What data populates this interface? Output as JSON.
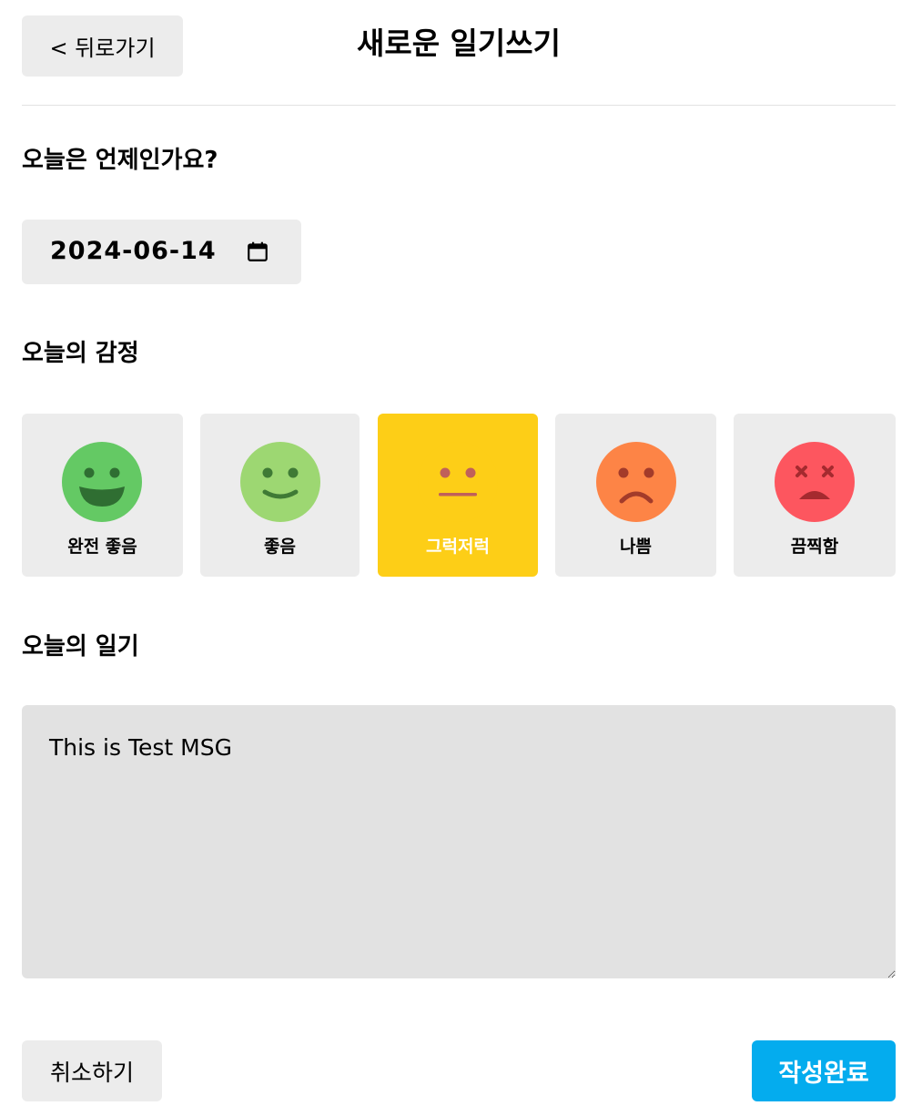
{
  "header": {
    "back_label": "< 뒤로가기",
    "title": "새로운 일기쓰기"
  },
  "date_section": {
    "title": "오늘은 언제인가요?",
    "date_value": "2024-06-14",
    "picker_icon": "calendar-icon"
  },
  "emotion_section": {
    "title": "오늘의 감정",
    "selected": "그럭저럭",
    "items": [
      {
        "label": "완전 좋음",
        "icon": "very-happy-face-icon",
        "color": "#64c964"
      },
      {
        "label": "좋음",
        "icon": "happy-face-icon",
        "color": "#9dd772"
      },
      {
        "label": "그럭저럭",
        "icon": "neutral-face-icon",
        "color": "#fdce17"
      },
      {
        "label": "나쁨",
        "icon": "sad-face-icon",
        "color": "#fd8446"
      },
      {
        "label": "끔찍함",
        "icon": "terrible-face-icon",
        "color": "#fd565f"
      }
    ]
  },
  "diary_section": {
    "title": "오늘의 일기",
    "text": "This is Test MSG"
  },
  "actions": {
    "cancel_label": "취소하기",
    "submit_label": "작성완료"
  },
  "colors": {
    "selected_card": "#fdce17",
    "submit_button": "#04acee",
    "card_background": "#ececec",
    "textarea_background": "#e2e2e2"
  }
}
